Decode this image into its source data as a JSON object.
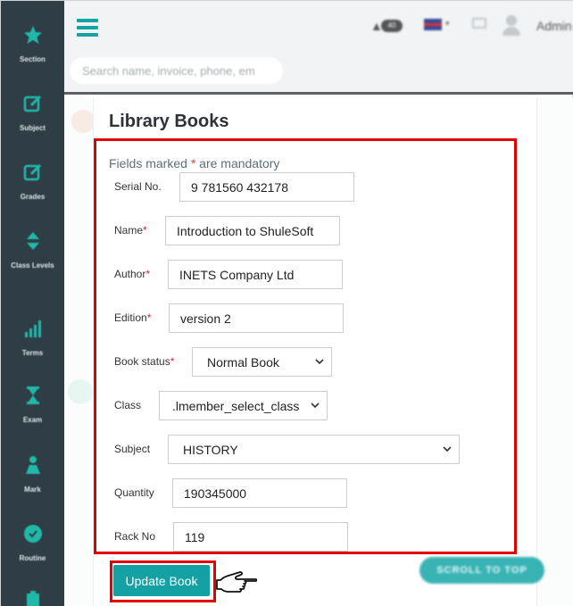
{
  "sidebar": {
    "items": [
      {
        "label": "Section",
        "icon": "star-icon"
      },
      {
        "label": "Subject",
        "icon": "edit-icon"
      },
      {
        "label": "Grades",
        "icon": "edit-icon"
      },
      {
        "label": "Class Levels",
        "icon": "sort-icon"
      },
      {
        "label": "Terms",
        "icon": "signal-bars-icon"
      },
      {
        "label": "Exam",
        "icon": "hourglass-icon"
      },
      {
        "label": "Mark",
        "icon": "flask-icon"
      },
      {
        "label": "Routine",
        "icon": "clock-icon"
      }
    ]
  },
  "topbar": {
    "search_placeholder": "Search name, invoice, phone, em",
    "notification_count": "40",
    "user_name": "Admin"
  },
  "page": {
    "title": "Library Books",
    "mandatory_prefix": "Fields marked",
    "mandatory_star": "*",
    "mandatory_suffix": "are mandatory"
  },
  "form": {
    "serial_label": "Serial No.",
    "serial_value": "9 781560 432178",
    "name_label": "Name",
    "name_value": "Introduction to ShuleSoft",
    "author_label": "Author",
    "author_value": "INETS Company Ltd",
    "edition_label": "Edition",
    "edition_value": "version 2",
    "book_status_label": "Book status",
    "book_status_value": "Normal Book",
    "class_label": "Class",
    "class_value": ".lmember_select_class",
    "subject_label": "Subject",
    "subject_value": "HISTORY",
    "quantity_label": "Quantity",
    "quantity_value": "190345000",
    "rack_label": "Rack No",
    "rack_value": "119",
    "required_marker": "*"
  },
  "actions": {
    "update_label": "Update Book",
    "scroll_top_label": "SCROLL TO TOP"
  },
  "colors": {
    "accent": "#13a1a4",
    "sidebar": "#2f3e46",
    "highlight": "#e30000"
  }
}
